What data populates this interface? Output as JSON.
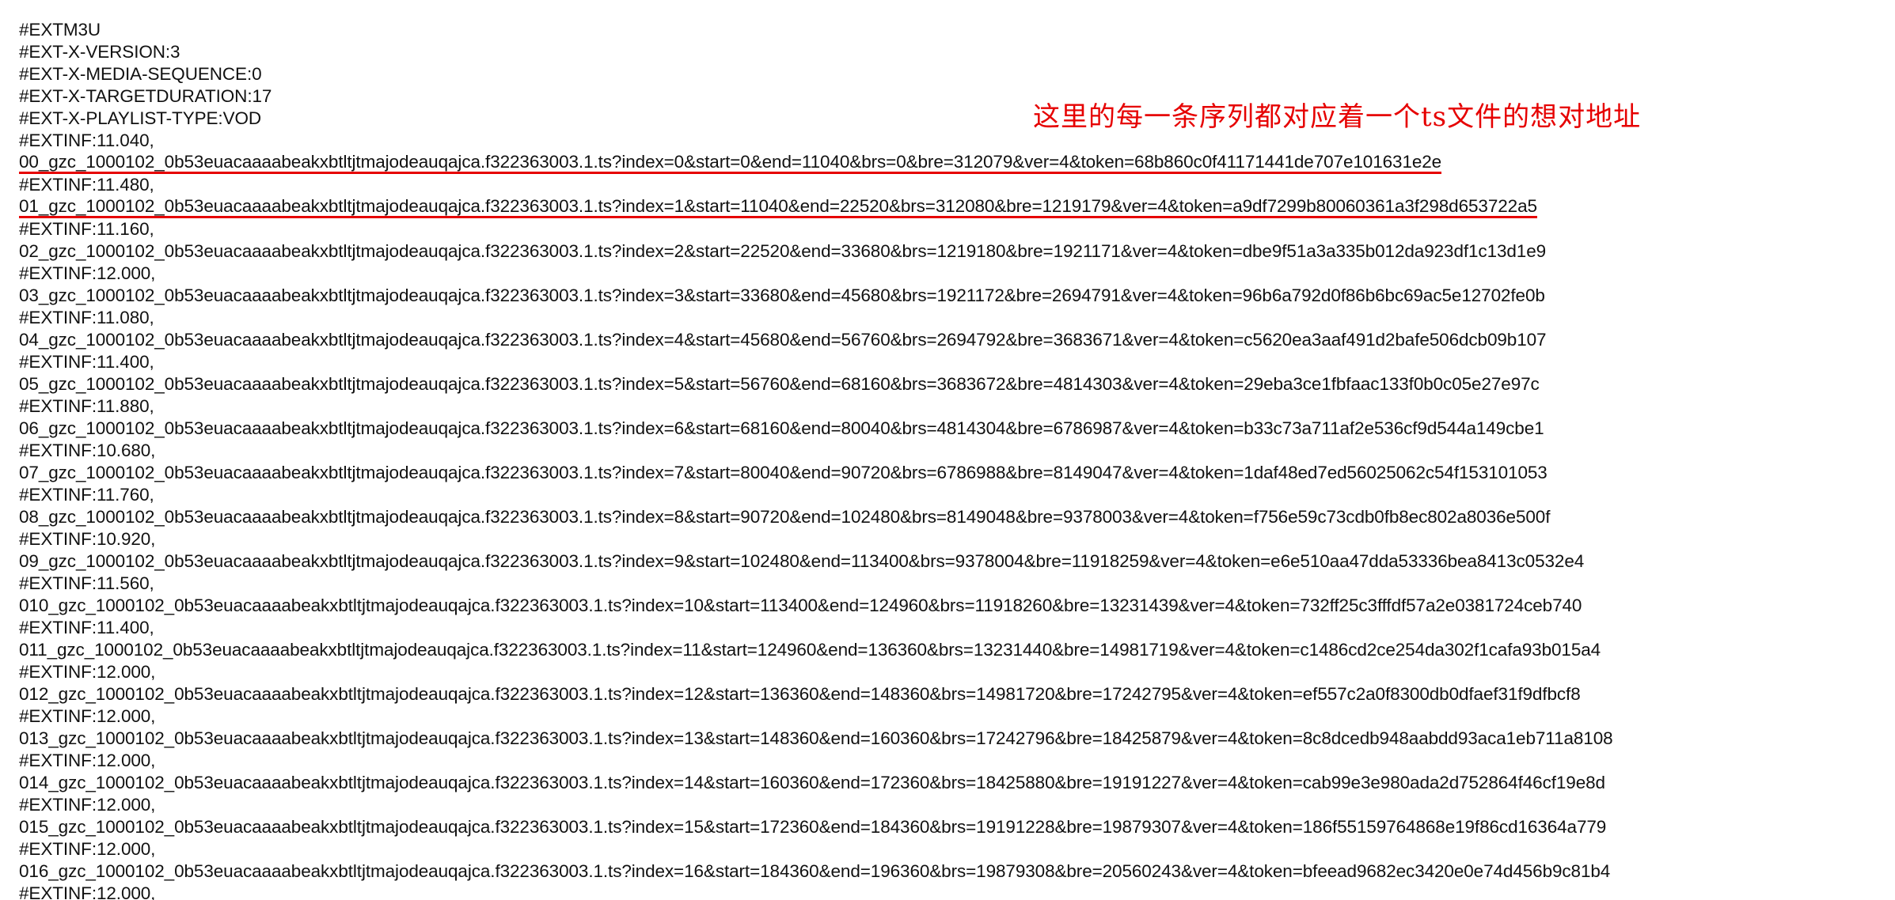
{
  "annotation": {
    "text": "这里的每一条序列都对应着一个ts文件的想对地址",
    "color": "#e60000"
  },
  "file": {
    "lines": [
      "#EXTM3U",
      "#EXT-X-VERSION:3",
      "#EXT-X-MEDIA-SEQUENCE:0",
      "#EXT-X-TARGETDURATION:17",
      "#EXT-X-PLAYLIST-TYPE:VOD",
      "#EXTINF:11.040,",
      "00_gzc_1000102_0b53euacaaaabeakxbtltjtmajodeauqajca.f322363003.1.ts?index=0&start=0&end=11040&brs=0&bre=312079&ver=4&token=68b860c0f41171441de707e101631e2e",
      "#EXTINF:11.480,",
      "01_gzc_1000102_0b53euacaaaabeakxbtltjtmajodeauqajca.f322363003.1.ts?index=1&start=11040&end=22520&brs=312080&bre=1219179&ver=4&token=a9df7299b80060361a3f298d653722a5",
      "#EXTINF:11.160,",
      "02_gzc_1000102_0b53euacaaaabeakxbtltjtmajodeauqajca.f322363003.1.ts?index=2&start=22520&end=33680&brs=1219180&bre=1921171&ver=4&token=dbe9f51a3a335b012da923df1c13d1e9",
      "#EXTINF:12.000,",
      "03_gzc_1000102_0b53euacaaaabeakxbtltjtmajodeauqajca.f322363003.1.ts?index=3&start=33680&end=45680&brs=1921172&bre=2694791&ver=4&token=96b6a792d0f86b6bc69ac5e12702fe0b",
      "#EXTINF:11.080,",
      "04_gzc_1000102_0b53euacaaaabeakxbtltjtmajodeauqajca.f322363003.1.ts?index=4&start=45680&end=56760&brs=2694792&bre=3683671&ver=4&token=c5620ea3aaf491d2bafe506dcb09b107",
      "#EXTINF:11.400,",
      "05_gzc_1000102_0b53euacaaaabeakxbtltjtmajodeauqajca.f322363003.1.ts?index=5&start=56760&end=68160&brs=3683672&bre=4814303&ver=4&token=29eba3ce1fbfaac133f0b0c05e27e97c",
      "#EXTINF:11.880,",
      "06_gzc_1000102_0b53euacaaaabeakxbtltjtmajodeauqajca.f322363003.1.ts?index=6&start=68160&end=80040&brs=4814304&bre=6786987&ver=4&token=b33c73a711af2e536cf9d544a149cbe1",
      "#EXTINF:10.680,",
      "07_gzc_1000102_0b53euacaaaabeakxbtltjtmajodeauqajca.f322363003.1.ts?index=7&start=80040&end=90720&brs=6786988&bre=8149047&ver=4&token=1daf48ed7ed56025062c54f153101053",
      "#EXTINF:11.760,",
      "08_gzc_1000102_0b53euacaaaabeakxbtltjtmajodeauqajca.f322363003.1.ts?index=8&start=90720&end=102480&brs=8149048&bre=9378003&ver=4&token=f756e59c73cdb0fb8ec802a8036e500f",
      "#EXTINF:10.920,",
      "09_gzc_1000102_0b53euacaaaabeakxbtltjtmajodeauqajca.f322363003.1.ts?index=9&start=102480&end=113400&brs=9378004&bre=11918259&ver=4&token=e6e510aa47dda53336bea8413c0532e4",
      "#EXTINF:11.560,",
      "010_gzc_1000102_0b53euacaaaabeakxbtltjtmajodeauqajca.f322363003.1.ts?index=10&start=113400&end=124960&brs=11918260&bre=13231439&ver=4&token=732ff25c3fffdf57a2e0381724ceb740",
      "#EXTINF:11.400,",
      "011_gzc_1000102_0b53euacaaaabeakxbtltjtmajodeauqajca.f322363003.1.ts?index=11&start=124960&end=136360&brs=13231440&bre=14981719&ver=4&token=c1486cd2ce254da302f1cafa93b015a4",
      "#EXTINF:12.000,",
      "012_gzc_1000102_0b53euacaaaabeakxbtltjtmajodeauqajca.f322363003.1.ts?index=12&start=136360&end=148360&brs=14981720&bre=17242795&ver=4&token=ef557c2a0f8300db0dfaef31f9dfbcf8",
      "#EXTINF:12.000,",
      "013_gzc_1000102_0b53euacaaaabeakxbtltjtmajodeauqajca.f322363003.1.ts?index=13&start=148360&end=160360&brs=17242796&bre=18425879&ver=4&token=8c8dcedb948aabdd93aca1eb711a8108",
      "#EXTINF:12.000,",
      "014_gzc_1000102_0b53euacaaaabeakxbtltjtmajodeauqajca.f322363003.1.ts?index=14&start=160360&end=172360&brs=18425880&bre=19191227&ver=4&token=cab99e3e980ada2d752864f46cf19e8d",
      "#EXTINF:12.000,",
      "015_gzc_1000102_0b53euacaaaabeakxbtltjtmajodeauqajca.f322363003.1.ts?index=15&start=172360&end=184360&brs=19191228&bre=19879307&ver=4&token=186f55159764868e19f86cd16364a779",
      "#EXTINF:12.000,",
      "016_gzc_1000102_0b53euacaaaabeakxbtltjtmajodeauqajca.f322363003.1.ts?index=16&start=184360&end=196360&brs=19879308&bre=20560243&ver=4&token=bfeead9682ec3420e0e74d456b9c81b4",
      "#EXTINF:12.000,"
    ]
  }
}
